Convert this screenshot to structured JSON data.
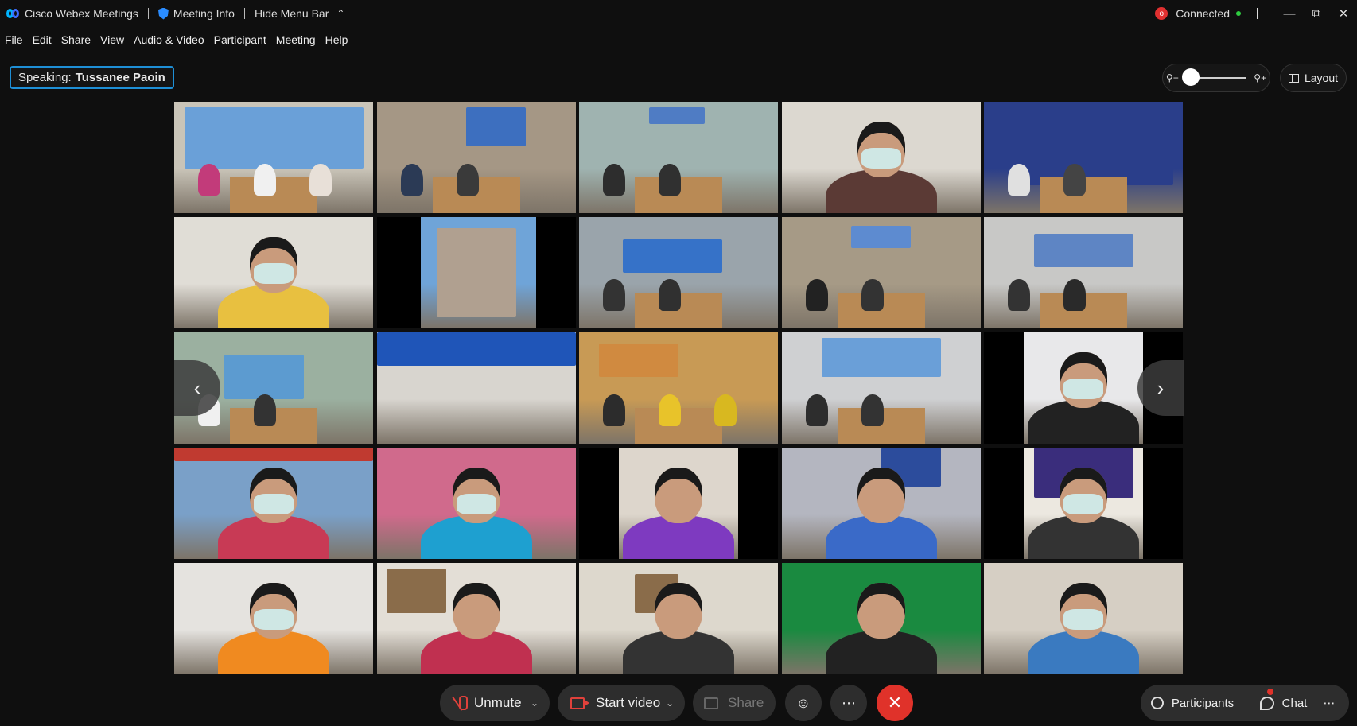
{
  "titlebar": {
    "app_name": "Cisco Webex Meetings",
    "meeting_info": "Meeting Info",
    "hide_menu": "Hide Menu Bar",
    "status": "Connected",
    "rec_label": "o"
  },
  "menu": [
    "File",
    "Edit",
    "Share",
    "View",
    "Audio & Video",
    "Participant",
    "Meeting",
    "Help"
  ],
  "speaking": {
    "prefix": "Speaking:",
    "name": "Tussanee Paoin"
  },
  "layout_label": "Layout",
  "zoom_level": 0.0,
  "controls": {
    "unmute": "Unmute",
    "start_video": "Start video",
    "share": "Share",
    "participants": "Participants",
    "chat": "Chat"
  },
  "colors": {
    "accent": "#1e8fd6",
    "end_button": "#e0322a",
    "muted_icon": "#e0413b",
    "connected": "#2ecc40"
  },
  "tiles_count": 25
}
